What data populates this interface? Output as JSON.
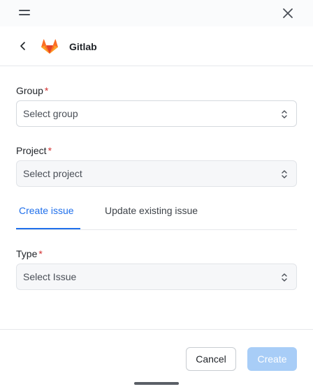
{
  "header": {
    "title": "Gitlab"
  },
  "form": {
    "group": {
      "label": "Group",
      "required_mark": "*",
      "value": "Select group"
    },
    "project": {
      "label": "Project",
      "required_mark": "*",
      "value": "Select project"
    },
    "tabs": [
      {
        "label": "Create issue",
        "active": true
      },
      {
        "label": "Update existing issue",
        "active": false
      }
    ],
    "type": {
      "label": "Type",
      "required_mark": "*",
      "value": "Select Issue"
    }
  },
  "footer": {
    "cancel_label": "Cancel",
    "create_label": "Create"
  },
  "colors": {
    "accent": "#1f6feb",
    "required": "#d32f2f",
    "create_disabled": "#a8cdf7",
    "gitlab_orange": "#fc6d26"
  },
  "icons": [
    "menu-icon",
    "close-icon",
    "back-icon",
    "gitlab-logo",
    "updown-chevron-icon"
  ]
}
